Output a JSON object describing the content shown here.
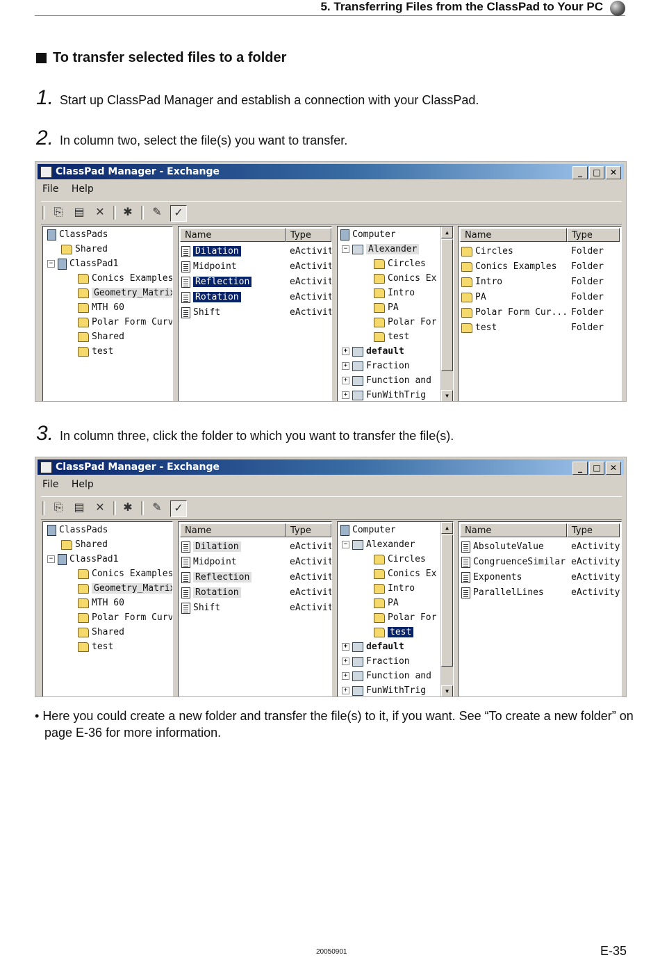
{
  "header": {
    "title": "5. Transferring Files from the ClassPad to Your PC"
  },
  "section_title": "To transfer selected files to a folder",
  "steps": [
    {
      "num": "1.",
      "text": "Start up ClassPad Manager and establish a connection with your ClassPad."
    },
    {
      "num": "2.",
      "text": "In column two, select the file(s) you want to transfer."
    },
    {
      "num": "3.",
      "text": "In column three, click the folder to which you want to transfer the file(s)."
    }
  ],
  "window": {
    "title": "ClassPad Manager - Exchange",
    "menu": [
      "File",
      "Help"
    ],
    "toolbar_icons": [
      "copy-icon",
      "paste-icon",
      "delete-icon",
      "new-folder-icon",
      "edit-icon",
      "exchange-icon"
    ],
    "tree1": [
      "ClassPads",
      "Shared",
      "ClassPad1",
      "Conics Examples",
      "Geometry_Matrix",
      "MTH 60",
      "Polar Form Curv",
      "Shared",
      "test"
    ],
    "files_header": {
      "name": "Name",
      "type": "Type"
    },
    "files": [
      {
        "name": "Dilation",
        "type": "eActivity"
      },
      {
        "name": "Midpoint",
        "type": "eActivity"
      },
      {
        "name": "Reflection",
        "type": "eActivity"
      },
      {
        "name": "Rotation",
        "type": "eActivity"
      },
      {
        "name": "Shift",
        "type": "eActivity"
      }
    ],
    "tree2": [
      "Computer",
      "Alexander",
      "Circles",
      "Conics Ex",
      "Intro",
      "PA",
      "Polar For",
      "test",
      "default",
      "Fraction",
      "Function and",
      "FunWithTrig"
    ],
    "right_header": {
      "name": "Name",
      "type": "Type"
    },
    "right1": [
      {
        "name": "Circles",
        "type": "Folder"
      },
      {
        "name": "Conics Examples",
        "type": "Folder"
      },
      {
        "name": "Intro",
        "type": "Folder"
      },
      {
        "name": "PA",
        "type": "Folder"
      },
      {
        "name": "Polar Form Cur...",
        "type": "Folder"
      },
      {
        "name": "test",
        "type": "Folder"
      }
    ],
    "right2": [
      {
        "name": "AbsoluteValue",
        "type": "eActivity"
      },
      {
        "name": "CongruenceSimilar",
        "type": "eActivity"
      },
      {
        "name": "Exponents",
        "type": "eActivity"
      },
      {
        "name": "ParallelLines",
        "type": "eActivity"
      }
    ]
  },
  "bullet": "Here you could create a new folder and transfer the file(s) to it, if you want. See “To create a new folder” on page E-36 for more information.",
  "footer": {
    "date": "20050901",
    "page": "E-35"
  }
}
